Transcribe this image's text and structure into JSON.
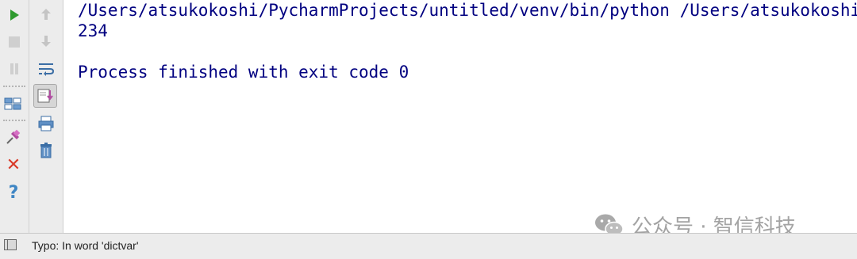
{
  "left_toolbar": {
    "icons": [
      "run-icon",
      "stop-icon",
      "pause-icon",
      "dump-threads-icon",
      "pin-tab-icon",
      "close-icon",
      "help-icon"
    ],
    "help_glyph": "?",
    "close_glyph": "✕",
    "run_color": "#2e9a2e",
    "close_color": "#d93b2a",
    "help_color": "#3f86c4"
  },
  "right_toolbar": {
    "icons": [
      "up-arrow-icon",
      "down-arrow-icon",
      "soft-wrap-icon",
      "scroll-to-end-icon",
      "print-icon",
      "trash-icon"
    ]
  },
  "console": {
    "lines": [
      "/Users/atsukokoshi/PycharmProjects/untitled/venv/bin/python /Users/atsukokoshi/",
      "234",
      "",
      "Process finished with exit code 0"
    ],
    "text_color": "#000080"
  },
  "status_bar": {
    "message": "Typo: In word 'dictvar'"
  },
  "watermark": {
    "text": "公众号 · 智信科技"
  }
}
